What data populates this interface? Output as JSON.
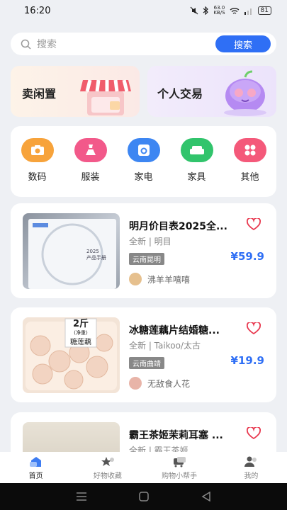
{
  "status": {
    "time": "16:20",
    "net_speed": "63.0",
    "net_unit": "KB/S",
    "battery": "81"
  },
  "search": {
    "placeholder": "搜索",
    "button": "搜索"
  },
  "banners": [
    {
      "label": "卖闲置"
    },
    {
      "label": "个人交易"
    }
  ],
  "categories": [
    {
      "label": "数码",
      "color": "#f7a33b"
    },
    {
      "label": "服装",
      "color": "#f2598a"
    },
    {
      "label": "家电",
      "color": "#3d86f2"
    },
    {
      "label": "家具",
      "color": "#31c46c"
    },
    {
      "label": "其他",
      "color": "#f4597a"
    }
  ],
  "products": [
    {
      "title": "明月价目表2025全...",
      "condition": "全新 | 明目",
      "location": "云南昆明",
      "price": "¥59.9",
      "seller": "沸羊羊嘻嘻",
      "image_text": "2025\n产品手册"
    },
    {
      "title": "冰糖莲藕片结婚糖...",
      "condition": "全新 | Taikoo/太古",
      "location": "云南曲靖",
      "price": "¥19.9",
      "seller": "无敌食人花",
      "image_text_1": "2斤",
      "image_text_2": "(净重)",
      "image_text_3": "糖莲藕"
    },
    {
      "title": "霸王茶姬茉莉耳塞 ...",
      "condition": "全新 | 霸王茶姬"
    }
  ],
  "tabs": [
    {
      "label": "首页",
      "active": true
    },
    {
      "label": "好物收藏"
    },
    {
      "label": "购物小帮手"
    },
    {
      "label": "我的"
    }
  ],
  "colors": {
    "accent": "#2f6ff5",
    "price": "#2f6ff5",
    "heart": "#e8364d"
  }
}
